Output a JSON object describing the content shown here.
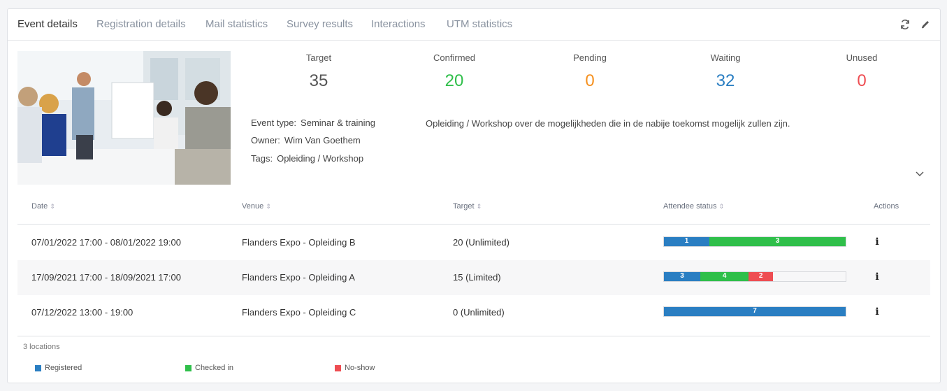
{
  "tabs": [
    "Event details",
    "Registration details",
    "Mail statistics",
    "Survey results",
    "Interactions",
    "UTM statistics"
  ],
  "toolbar": {
    "refresh_icon": "refresh-icon",
    "edit_icon": "pencil-icon"
  },
  "stats": [
    {
      "label": "Target",
      "value": "35",
      "color": "#555555"
    },
    {
      "label": "Confirmed",
      "value": "20",
      "color": "#2fbf4a"
    },
    {
      "label": "Pending",
      "value": "0",
      "color": "#f5901e"
    },
    {
      "label": "Waiting",
      "value": "32",
      "color": "#2a7ec2"
    },
    {
      "label": "Unused",
      "value": "0",
      "color": "#ee4d52"
    }
  ],
  "meta": {
    "event_type_key": "Event type:",
    "event_type": "Seminar & training",
    "owner_key": "Owner:",
    "owner": "Wim Van Goethem",
    "tags_key": "Tags:",
    "tags": "Opleiding / Workshop",
    "description": "Opleiding / Workshop over de mogelijkheden die in de nabije toekomst mogelijk zullen zijn."
  },
  "table": {
    "headers": [
      "Date",
      "Venue",
      "Target",
      "Attendee status",
      "Actions"
    ],
    "rows": [
      {
        "date": "07/01/2022 17:00 - 08/01/2022 19:00",
        "venue": "Flanders Expo - Opleiding B",
        "target": "20 (Unlimited)",
        "status": [
          {
            "kind": "registered",
            "label": "1",
            "fraction": 0.25
          },
          {
            "kind": "checked_in",
            "label": "3",
            "fraction": 0.75
          }
        ]
      },
      {
        "date": "17/09/2021 17:00 - 18/09/2021 17:00",
        "venue": "Flanders Expo - Opleiding A",
        "target": "15 (Limited)",
        "status": [
          {
            "kind": "registered",
            "label": "3",
            "fraction": 0.2
          },
          {
            "kind": "checked_in",
            "label": "4",
            "fraction": 0.2667
          },
          {
            "kind": "no_show",
            "label": "2",
            "fraction": 0.1333
          }
        ]
      },
      {
        "date": "07/12/2022 13:00 - 19:00",
        "venue": "Flanders Expo - Opleiding C",
        "target": "0 (Unlimited)",
        "status": [
          {
            "kind": "registered",
            "label": "7",
            "fraction": 1.0
          }
        ]
      }
    ]
  },
  "footer": {
    "locations": "3 locations"
  },
  "legend": [
    {
      "kind": "registered",
      "label": "Registered"
    },
    {
      "kind": "checked_in",
      "label": "Checked in"
    },
    {
      "kind": "no_show",
      "label": "No-show"
    }
  ],
  "colors": {
    "registered": "#2a7ec2",
    "checked_in": "#2fbf4a",
    "no_show": "#ee4d52"
  }
}
